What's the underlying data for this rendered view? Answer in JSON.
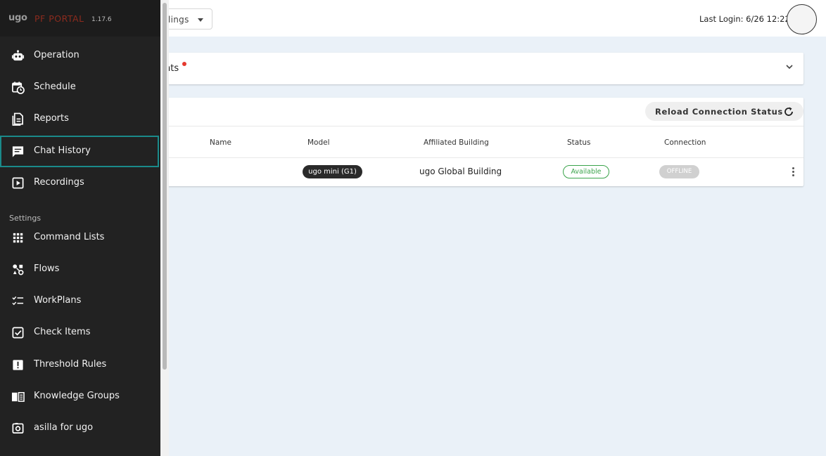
{
  "header": {
    "building_select_text": "lings",
    "last_login": "Last Login: 6/26 12:22"
  },
  "sidebar": {
    "logo": "ugo",
    "portal": "PF PORTAL",
    "version": "1.17.6",
    "items": [
      {
        "label": "Operation",
        "icon": "robot-icon"
      },
      {
        "label": "Schedule",
        "icon": "calendar-clock-icon"
      },
      {
        "label": "Reports",
        "icon": "report-icon"
      },
      {
        "label": "Chat History",
        "icon": "chat-icon",
        "active": true
      },
      {
        "label": "Recordings",
        "icon": "play-box-icon"
      }
    ],
    "settings_label": "Settings",
    "settings_items": [
      {
        "label": "Command Lists",
        "icon": "grid-icon"
      },
      {
        "label": "Flows",
        "icon": "flow-icon"
      },
      {
        "label": "WorkPlans",
        "icon": "checklist-icon"
      },
      {
        "label": "Check Items",
        "icon": "check-box-icon"
      },
      {
        "label": "Threshold Rules",
        "icon": "alert-box-icon"
      },
      {
        "label": "Knowledge Groups",
        "icon": "book-icon"
      },
      {
        "label": "asilla for ugo",
        "icon": "camera-icon"
      }
    ]
  },
  "notice": {
    "text": "nts"
  },
  "robots": {
    "reload_label": "Reload Connection Status",
    "columns": [
      "Name",
      "Model",
      "Affiliated Building",
      "Status",
      "Connection"
    ],
    "rows": [
      {
        "name": "",
        "model": "ugo mini (G1)",
        "building": "ugo Global Building",
        "status": "Available",
        "connection": "OFFLINE"
      }
    ]
  },
  "colors": {
    "sidebar_bg": "#222222",
    "active_border": "#1a8a8a",
    "main_bg": "#eaf1f8",
    "status_green": "#3aa34a",
    "notice_dot": "#e5392e"
  }
}
